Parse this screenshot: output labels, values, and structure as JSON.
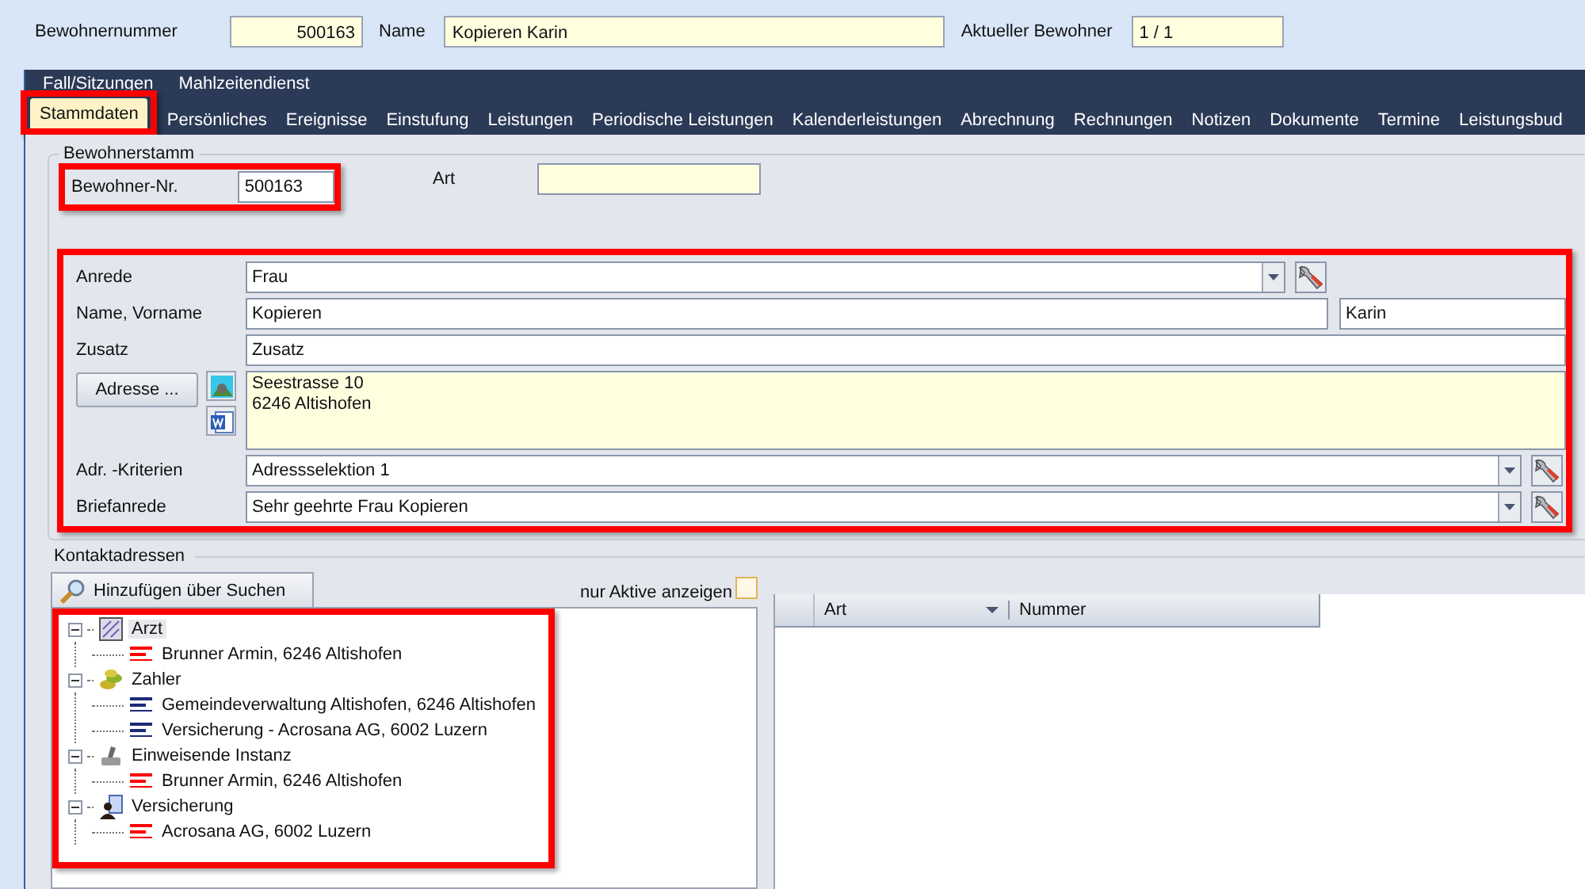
{
  "header": {
    "resident_number": {
      "label": "Bewohnernummer",
      "value": "500163"
    },
    "name": {
      "label": "Name",
      "value": "Kopieren Karin"
    },
    "current_resident": {
      "label": "Aktueller Bewohner",
      "value": "1 / 1"
    }
  },
  "nav": {
    "top_items": [
      "Fall/Sitzungen",
      "Mahlzeitendienst"
    ],
    "tabs": [
      {
        "label": "Stammdaten",
        "selected": true,
        "highlighted": true
      },
      {
        "label": "Persönliches",
        "selected": false,
        "highlighted": false
      },
      {
        "label": "Ereignisse",
        "selected": false,
        "highlighted": false
      },
      {
        "label": "Einstufung",
        "selected": false,
        "highlighted": false
      },
      {
        "label": "Leistungen",
        "selected": false,
        "highlighted": false
      },
      {
        "label": "Periodische Leistungen",
        "selected": false,
        "highlighted": false
      },
      {
        "label": "Kalenderleistungen",
        "selected": false,
        "highlighted": false
      },
      {
        "label": "Abrechnung",
        "selected": false,
        "highlighted": false
      },
      {
        "label": "Rechnungen",
        "selected": false,
        "highlighted": false
      },
      {
        "label": "Notizen",
        "selected": false,
        "highlighted": false
      },
      {
        "label": "Dokumente",
        "selected": false,
        "highlighted": false
      },
      {
        "label": "Termine",
        "selected": false,
        "highlighted": false
      },
      {
        "label": "Leistungsbud",
        "selected": false,
        "highlighted": false
      }
    ]
  },
  "master": {
    "title": "Bewohnerstamm",
    "number": {
      "label": "Bewohner-Nr.",
      "value": "500163",
      "highlighted": true
    },
    "art": {
      "label": "Art"
    },
    "form": {
      "highlighted": true,
      "salutation": {
        "label": "Anrede",
        "value": "Frau"
      },
      "name": {
        "label": "Name, Vorname",
        "last": "Kopieren",
        "first": "Karin"
      },
      "suffix": {
        "label": "Zusatz",
        "value": "Zusatz"
      },
      "address": {
        "button": "Adresse ...",
        "lines": [
          "Seestrasse 10",
          "6246 Altishofen"
        ]
      },
      "criteria": {
        "label": "Adr. -Kriterien",
        "value": "Adressselektion 1"
      },
      "letter_salutation": {
        "label": "Briefanrede",
        "value": "Sehr geehrte Frau Kopieren"
      }
    }
  },
  "contacts": {
    "title": "Kontaktadressen",
    "add_button": "Hinzufügen über Suchen",
    "active_only": {
      "label": "nur Aktive anzeigen",
      "checked": false
    },
    "tree": {
      "highlighted": true,
      "nodes": [
        {
          "label": "Arzt",
          "kind": "doctor",
          "selected": true,
          "expanded": true,
          "children": [
            {
              "label": "Brunner Armin, 6246 Altishofen",
              "color": "#ff0000",
              "selected": false
            }
          ]
        },
        {
          "label": "Zahler",
          "kind": "payer",
          "selected": false,
          "expanded": true,
          "children": [
            {
              "label": "Gemeindeverwaltung Altishofen, 6246 Altishofen",
              "color": "#1c2a78",
              "selected": false
            },
            {
              "label": "Versicherung - Acrosana AG, 6002 Luzern",
              "color": "#1c2a78",
              "selected": false
            }
          ]
        },
        {
          "label": "Einweisende Instanz",
          "kind": "referrer",
          "selected": false,
          "expanded": true,
          "children": [
            {
              "label": "Brunner Armin, 6246 Altishofen",
              "color": "#ff0000",
              "selected": false
            }
          ]
        },
        {
          "label": "Versicherung",
          "kind": "insurance",
          "selected": false,
          "expanded": true,
          "children": [
            {
              "label": "Acrosana AG, 6002 Luzern",
              "color": "#ff0000",
              "selected": false
            }
          ]
        }
      ]
    },
    "table": {
      "columns": [
        "Art",
        "Nummer"
      ]
    }
  }
}
